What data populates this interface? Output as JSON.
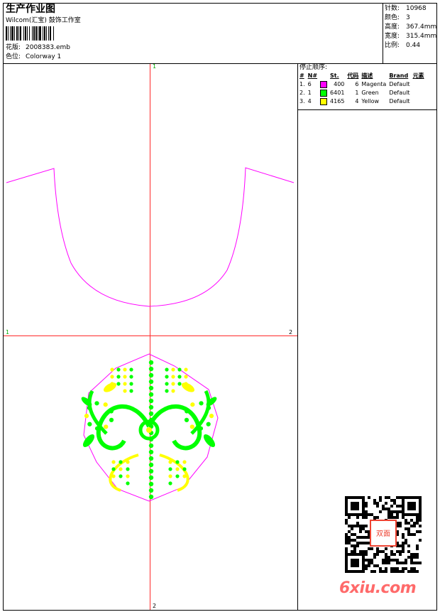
{
  "header": {
    "title": "生产作业图",
    "company": "Wilcom(汇宝) 鼓饰工作室",
    "design_label": "花版:",
    "design_value": "2008383.emb",
    "colorway_label": "色位:",
    "colorway_value": "Colorway 1"
  },
  "stats": {
    "stitches_label": "针数:",
    "stitches_value": "10968",
    "colors_label": "颜色:",
    "colors_value": "3",
    "height_label": "高度:",
    "height_value": "367.4mm",
    "width_label": "宽度:",
    "width_value": "315.4mm",
    "scale_label": "比例:",
    "scale_value": "0.44"
  },
  "stop_sequence": {
    "title": "停止顺序:",
    "headers": [
      "#",
      "N#",
      "St.",
      "代码",
      "描述",
      "Brand",
      "元素"
    ],
    "rows": [
      {
        "idx": "1.",
        "n": "6",
        "color": "#ff00ff",
        "st": "400",
        "code": "6",
        "desc": "Magenta",
        "brand": "Default",
        "elem": ""
      },
      {
        "idx": "2.",
        "n": "1",
        "color": "#00ff00",
        "st": "6401",
        "code": "1",
        "desc": "Green",
        "brand": "Default",
        "elem": ""
      },
      {
        "idx": "3.",
        "n": "4",
        "color": "#ffff00",
        "st": "4165",
        "code": "4",
        "desc": "Yellow",
        "brand": "Default",
        "elem": ""
      }
    ]
  },
  "axes": {
    "top": "1",
    "bottom": "2",
    "left": "1",
    "right": "2"
  },
  "watermark": {
    "site": "6xiu.com",
    "stamp": "双面"
  },
  "colors": {
    "magenta": "#ff00ff",
    "green": "#00ff00",
    "yellow": "#ffff00",
    "guide_red": "#ff2a2a"
  }
}
